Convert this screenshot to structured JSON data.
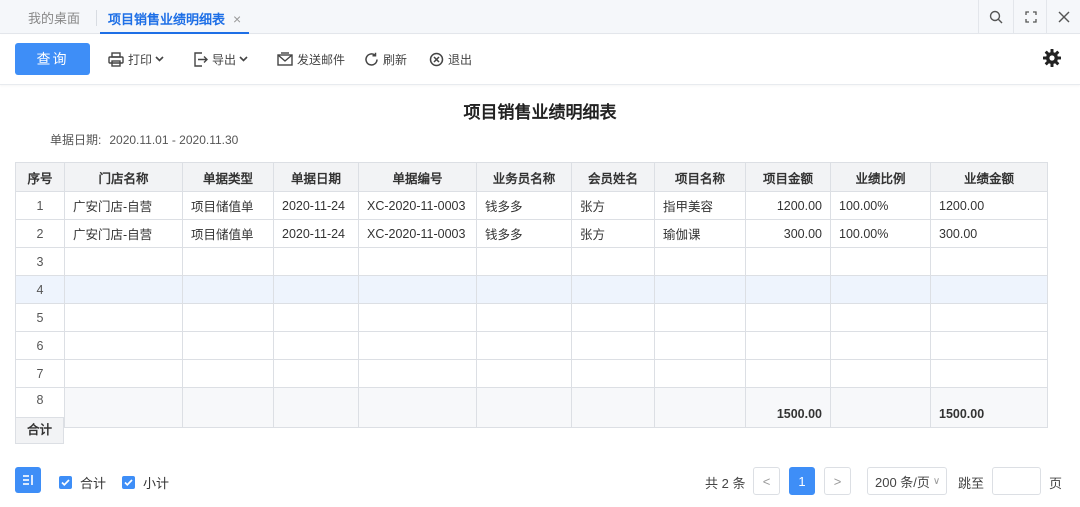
{
  "tabs": {
    "home": "我的桌面",
    "active": "项目销售业绩明细表",
    "close": "×"
  },
  "toolbar": {
    "query": "查询",
    "print": "打印",
    "export": "导出",
    "mail": "发送邮件",
    "refresh": "刷新",
    "exit": "退出"
  },
  "report": {
    "title": "项目销售业绩明细表",
    "date_label": "单据日期:",
    "date_value": "2020.11.01 - 2020.11.30"
  },
  "table": {
    "headers": [
      "序号",
      "门店名称",
      "单据类型",
      "单据日期",
      "单据编号",
      "业务员名称",
      "会员姓名",
      "项目名称",
      "项目金额",
      "业绩比例",
      "业绩金额"
    ],
    "rows": [
      [
        "1",
        "广安门店-自营",
        "项目储值单",
        "2020-11-24",
        "XC-2020-11-0003",
        "钱多多",
        "张方",
        "指甲美容",
        "1200.00",
        "100.00%",
        "1200.00"
      ],
      [
        "2",
        "广安门店-自营",
        "项目储值单",
        "2020-11-24",
        "XC-2020-11-0003",
        "钱多多",
        "张方",
        "瑜伽课",
        "300.00",
        "100.00%",
        "300.00"
      ],
      [
        "3",
        "",
        "",
        "",
        "",
        "",
        "",
        "",
        "",
        "",
        ""
      ],
      [
        "4",
        "",
        "",
        "",
        "",
        "",
        "",
        "",
        "",
        "",
        ""
      ],
      [
        "5",
        "",
        "",
        "",
        "",
        "",
        "",
        "",
        "",
        "",
        ""
      ],
      [
        "6",
        "",
        "",
        "",
        "",
        "",
        "",
        "",
        "",
        "",
        ""
      ],
      [
        "7",
        "",
        "",
        "",
        "",
        "",
        "",
        "",
        "",
        "",
        ""
      ],
      [
        "8",
        "",
        "",
        "",
        "",
        "",
        "",
        "",
        "",
        "",
        ""
      ]
    ],
    "total_label": "合计",
    "total_amount": "1500.00",
    "total_perf": "1500.00"
  },
  "footer": {
    "chk_total": "合计",
    "chk_sub": "小计",
    "total_count": "共 2 条",
    "prev": "<",
    "current_page": "1",
    "next": ">",
    "page_size": "200 条/页",
    "goto": "跳至",
    "page_unit": "页"
  },
  "colors": {
    "accent": "#3e8ef7",
    "tab_active": "#1e6fe6",
    "row_highlight": "#eef4fd"
  }
}
